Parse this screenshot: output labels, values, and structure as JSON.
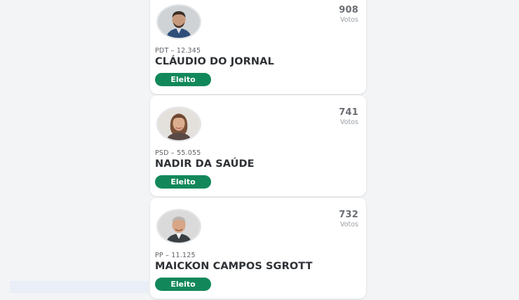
{
  "colors": {
    "status_green": "#12885a",
    "card_bg": "#ffffff",
    "page_bg": "#f3f4f5"
  },
  "candidates": [
    {
      "votes": "908",
      "votes_label": "Votos",
      "party": "PDT – 12.345",
      "name": "CLÁUDIO DO JORNAL",
      "status": "Eleito",
      "photo_icon": "male-portrait-photo"
    },
    {
      "votes": "741",
      "votes_label": "Votos",
      "party": "PSD – 55.055",
      "name": "NADIR DA SAÚDE",
      "status": "Eleito",
      "photo_icon": "female-portrait-photo"
    },
    {
      "votes": "732",
      "votes_label": "Votos",
      "party": "PP – 11.125",
      "name": "MAICKON CAMPOS SGROTT",
      "status": "Eleito",
      "photo_icon": "male-portrait-photo"
    }
  ]
}
